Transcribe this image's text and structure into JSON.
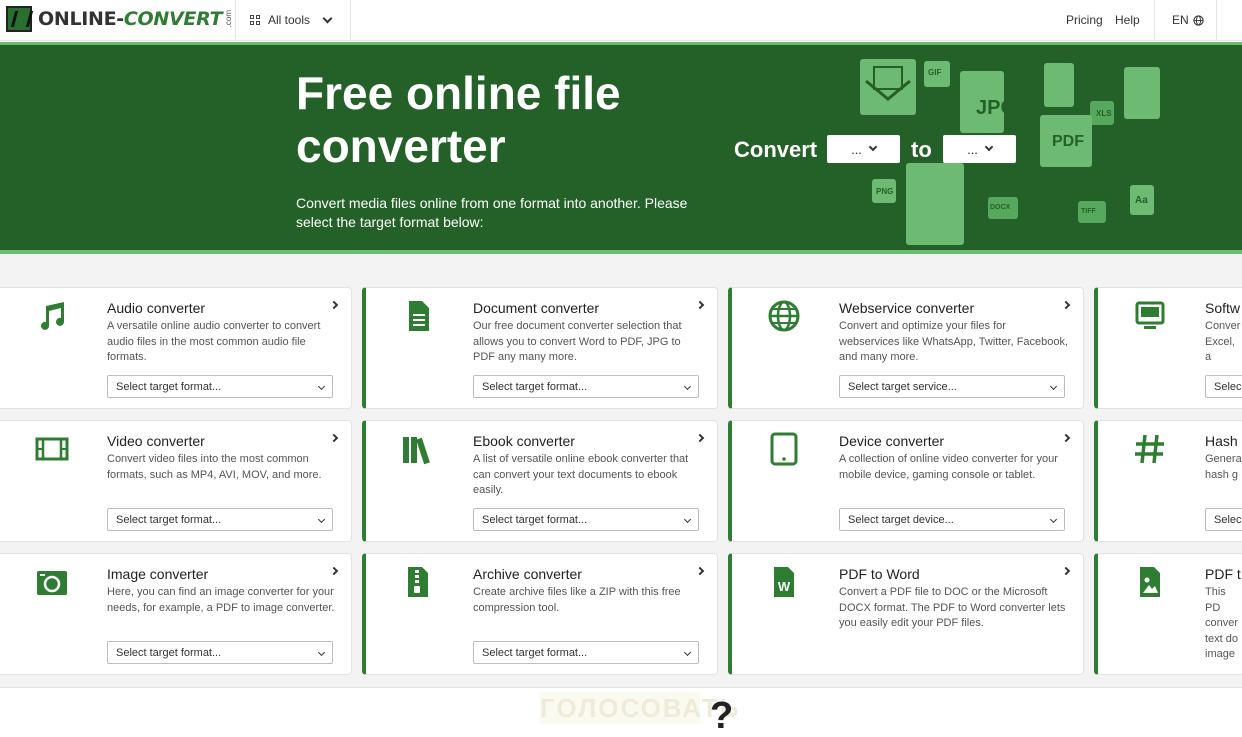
{
  "nav": {
    "logo_main": "ONLINE-",
    "logo_convert": "CONVERT",
    "logo_com": ".com",
    "all_tools": "All tools",
    "pricing": "Pricing",
    "help": "Help",
    "language": "EN"
  },
  "hero": {
    "title_line1": "Free online file",
    "title_line2": "converter",
    "subtitle": "Convert media files online from one format into another. Please select the target format below:",
    "convert_label": "Convert",
    "to_label": "to",
    "from_value": "...",
    "to_value": "...",
    "deco_labels": [
      "GIF",
      "JPG",
      "XLS",
      "PDF",
      "PNG",
      "DOCX",
      "TIFF",
      "Aa"
    ]
  },
  "cards": [
    {
      "title": "Audio converter",
      "desc": "A versatile online audio converter to convert audio files in the most common audio file formats.",
      "select": "Select target format...",
      "icon": "music-note-icon"
    },
    {
      "title": "Document converter",
      "desc": "Our free document converter selection that allows you to convert Word to PDF, JPG to PDF any many more.",
      "select": "Select target format...",
      "icon": "document-icon"
    },
    {
      "title": "Webservice converter",
      "desc": "Convert and optimize your files for webservices like WhatsApp, Twitter, Facebook, and many more.",
      "select": "Select target service...",
      "icon": "globe-icon"
    },
    {
      "title": "Softw",
      "desc": "Conver Excel, a",
      "select": "Selec",
      "icon": "monitor-icon"
    },
    {
      "title": "Video converter",
      "desc": "Convert video files into the most common formats, such as MP4, AVI, MOV, and more.",
      "select": "Select target format...",
      "icon": "film-icon"
    },
    {
      "title": "Ebook converter",
      "desc": "A list of versatile online ebook converter that can convert your text documents to ebook easily.",
      "select": "Select target format...",
      "icon": "books-icon"
    },
    {
      "title": "Device converter",
      "desc": "A collection of online video converter for your mobile device, gaming console or tablet.",
      "select": "Select target device...",
      "icon": "tablet-icon"
    },
    {
      "title": "Hash",
      "desc": "Genera hash g",
      "select": "Selec",
      "icon": "hash-icon"
    },
    {
      "title": "Image converter",
      "desc": "Here, you can find an image converter for your needs, for example, a PDF to image converter.",
      "select": "Select target format...",
      "icon": "camera-icon"
    },
    {
      "title": "Archive converter",
      "desc": "Create archive files like a ZIP with this free compression tool.",
      "select": "Select target format...",
      "icon": "archive-icon"
    },
    {
      "title": "PDF to Word",
      "desc": "Convert a PDF file to DOC or the Microsoft DOCX format. The PDF to Word converter lets you easily edit your PDF files.",
      "select": "",
      "icon": "word-file-icon"
    },
    {
      "title": "PDF t",
      "desc": "This PD conver text do image",
      "select": "",
      "icon": "image-file-icon"
    }
  ],
  "bottom": {
    "ghost_text": "ГОЛОСОВАТЬ",
    "question_mark": "?"
  },
  "colors": {
    "brand_green": "#236128",
    "accent_green": "#2f7d32",
    "light_green": "#6dbb73"
  }
}
